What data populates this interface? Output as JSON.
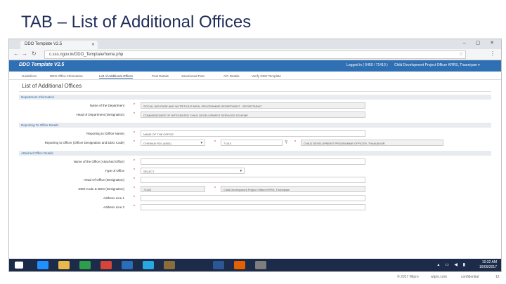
{
  "slide": {
    "title": "TAB – List of Additional Offices"
  },
  "browser": {
    "tab_label": "DDO Template V2.5",
    "url": "c.sss.ngov.in/DDO_Template/home.php",
    "window_controls": "– ▢ ✕"
  },
  "app": {
    "brand": "DDO Template V2.5",
    "login_info": "Logged in ( 6459 / 71410 )",
    "user_info": "Child Development Project Officer KRRS, Thanniyam ▾",
    "menu": [
      "Guidelines",
      "DDO Office Information",
      "List of Additional Offices",
      "Post Details",
      "Sanctioned Post",
      "A/C Details",
      "Verify DDO Template"
    ],
    "page_title": "List of Additional Offices"
  },
  "sections": {
    "department": {
      "heading": "Department Information",
      "name_label": "Name of the Department",
      "name_value": "SOCIAL WELFARE AND NUTRITIOUS MEAL PROGRAMME DEPARTMENT - SECRETARIAT",
      "hod_label": "Head of Department (Designation)",
      "hod_value": "COMMISSIONER OF INTEGRATED CHILD DEVELOPMENT SERVICES SCHEME"
    },
    "reporting": {
      "heading": "Reporting To Office Details",
      "office_label": "Reporting to (Office Name)",
      "office_value": "NAME OF THE OFFICE",
      "officer_label": "Reporting to Officer (Officer Designation and DDO Code)",
      "officer_select": "CHENNAI RD1 (6551)",
      "officer_code": "71410",
      "officer_desc": "CHILD DEVELOPMENT PROGRAMME OFFICER, THANJAVUR"
    },
    "attached": {
      "heading": "Attached Office Details",
      "name_label": "Name of the Office (Attached Office)",
      "type_label": "Type of Office",
      "type_value": "SELECT",
      "head_label": "Head Of Office (Designation)",
      "ddo_label": "DDO Code & DDO (Designation)",
      "ddo_code": "71402",
      "ddo_value": "Child Development Project Officer KRRS, Thanniyam",
      "addr1_label": "Address Line 1",
      "addr2_label": "Address Line 2"
    }
  },
  "taskbar": {
    "time": "10:32 AM",
    "date": "16/05/2017",
    "icons": [
      "windows-start",
      "internet-explorer",
      "file-explorer",
      "store",
      "chrome",
      "outlook",
      "skype",
      "photo",
      "word",
      "firefox",
      "other"
    ]
  },
  "footer": {
    "copyright": "© 2017 Wipro",
    "site": "wipro.com",
    "classification": "confidential",
    "page": "12"
  },
  "colors": {
    "accent": "#2f6fb3",
    "taskbar": "#1c2b4a",
    "title": "#1f2d5a"
  }
}
